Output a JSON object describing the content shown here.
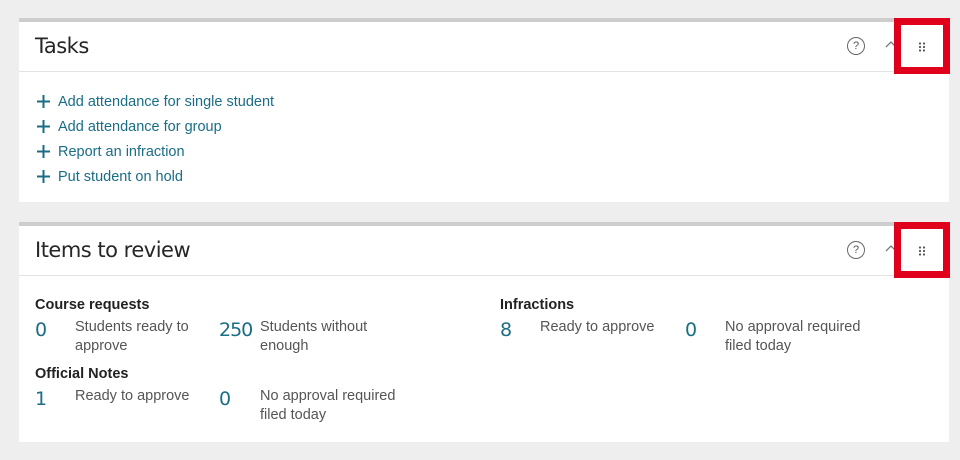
{
  "tasks": {
    "title": "Tasks",
    "help_symbol": "?",
    "items": [
      {
        "label": "Add attendance for single student"
      },
      {
        "label": "Add attendance for group"
      },
      {
        "label": "Report an infraction"
      },
      {
        "label": "Put student on hold"
      }
    ]
  },
  "review": {
    "title": "Items to review",
    "help_symbol": "?",
    "course_requests": {
      "title": "Course requests",
      "ready": {
        "value": "0",
        "label_1": "Students ready to",
        "label_2": "approve"
      },
      "without": {
        "value": "250",
        "label_1": "Students without",
        "label_2": "enough"
      }
    },
    "official_notes": {
      "title": "Official Notes",
      "ready": {
        "value": "1",
        "label_1": "Ready to approve"
      },
      "no_approval": {
        "value": "0",
        "label_1": "No approval required",
        "label_2": "filed today"
      }
    },
    "infractions": {
      "title": "Infractions",
      "ready": {
        "value": "8",
        "label_1": "Ready to approve"
      },
      "no_approval": {
        "value": "0",
        "label_1": "No approval required",
        "label_2": "filed today"
      }
    }
  },
  "colors": {
    "accent": "#1a6d86",
    "highlight": "#e0001b"
  },
  "icons": [
    "help-icon",
    "chevron-up-icon",
    "drag-handle-icon",
    "plus-icon"
  ]
}
